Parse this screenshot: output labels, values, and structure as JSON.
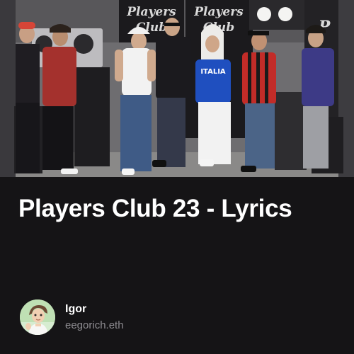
{
  "post": {
    "title": "Players Club 23 - Lyrics",
    "cover_image": {
      "description_icon": "photo-icon",
      "banner_left_line1": "Players",
      "banner_left_line2": "Club",
      "banner_right_line1": "Players",
      "banner_right_line2": "Club",
      "shirt_text": "ITALIA"
    }
  },
  "author": {
    "name": "Igor",
    "handle": "eegorich.eth",
    "avatar_icon": "avatar-icon"
  },
  "colors": {
    "background": "#151416",
    "title": "#ffffff",
    "handle": "#8e8c91"
  }
}
